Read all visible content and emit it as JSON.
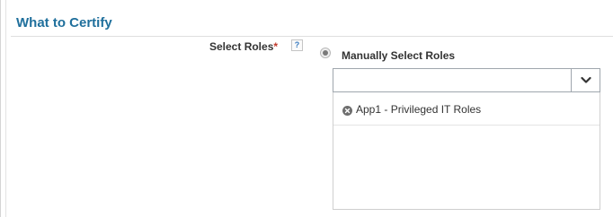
{
  "section": {
    "title": "What to Certify"
  },
  "select_roles": {
    "label": "Select Roles",
    "required_marker": "*",
    "help_glyph": "?"
  },
  "mode_radio": {
    "label": "Manually Select Roles",
    "selected": true
  },
  "roles_combo": {
    "value": "",
    "placeholder": "",
    "dropdown_icon": "chevron-down-icon"
  },
  "selected_roles": {
    "items": [
      {
        "label": "App1 - Privileged IT Roles",
        "remove_icon": "remove-circle-icon"
      }
    ]
  },
  "colors": {
    "title": "#1f6f9c",
    "required": "#c0392b",
    "text": "#333333"
  }
}
